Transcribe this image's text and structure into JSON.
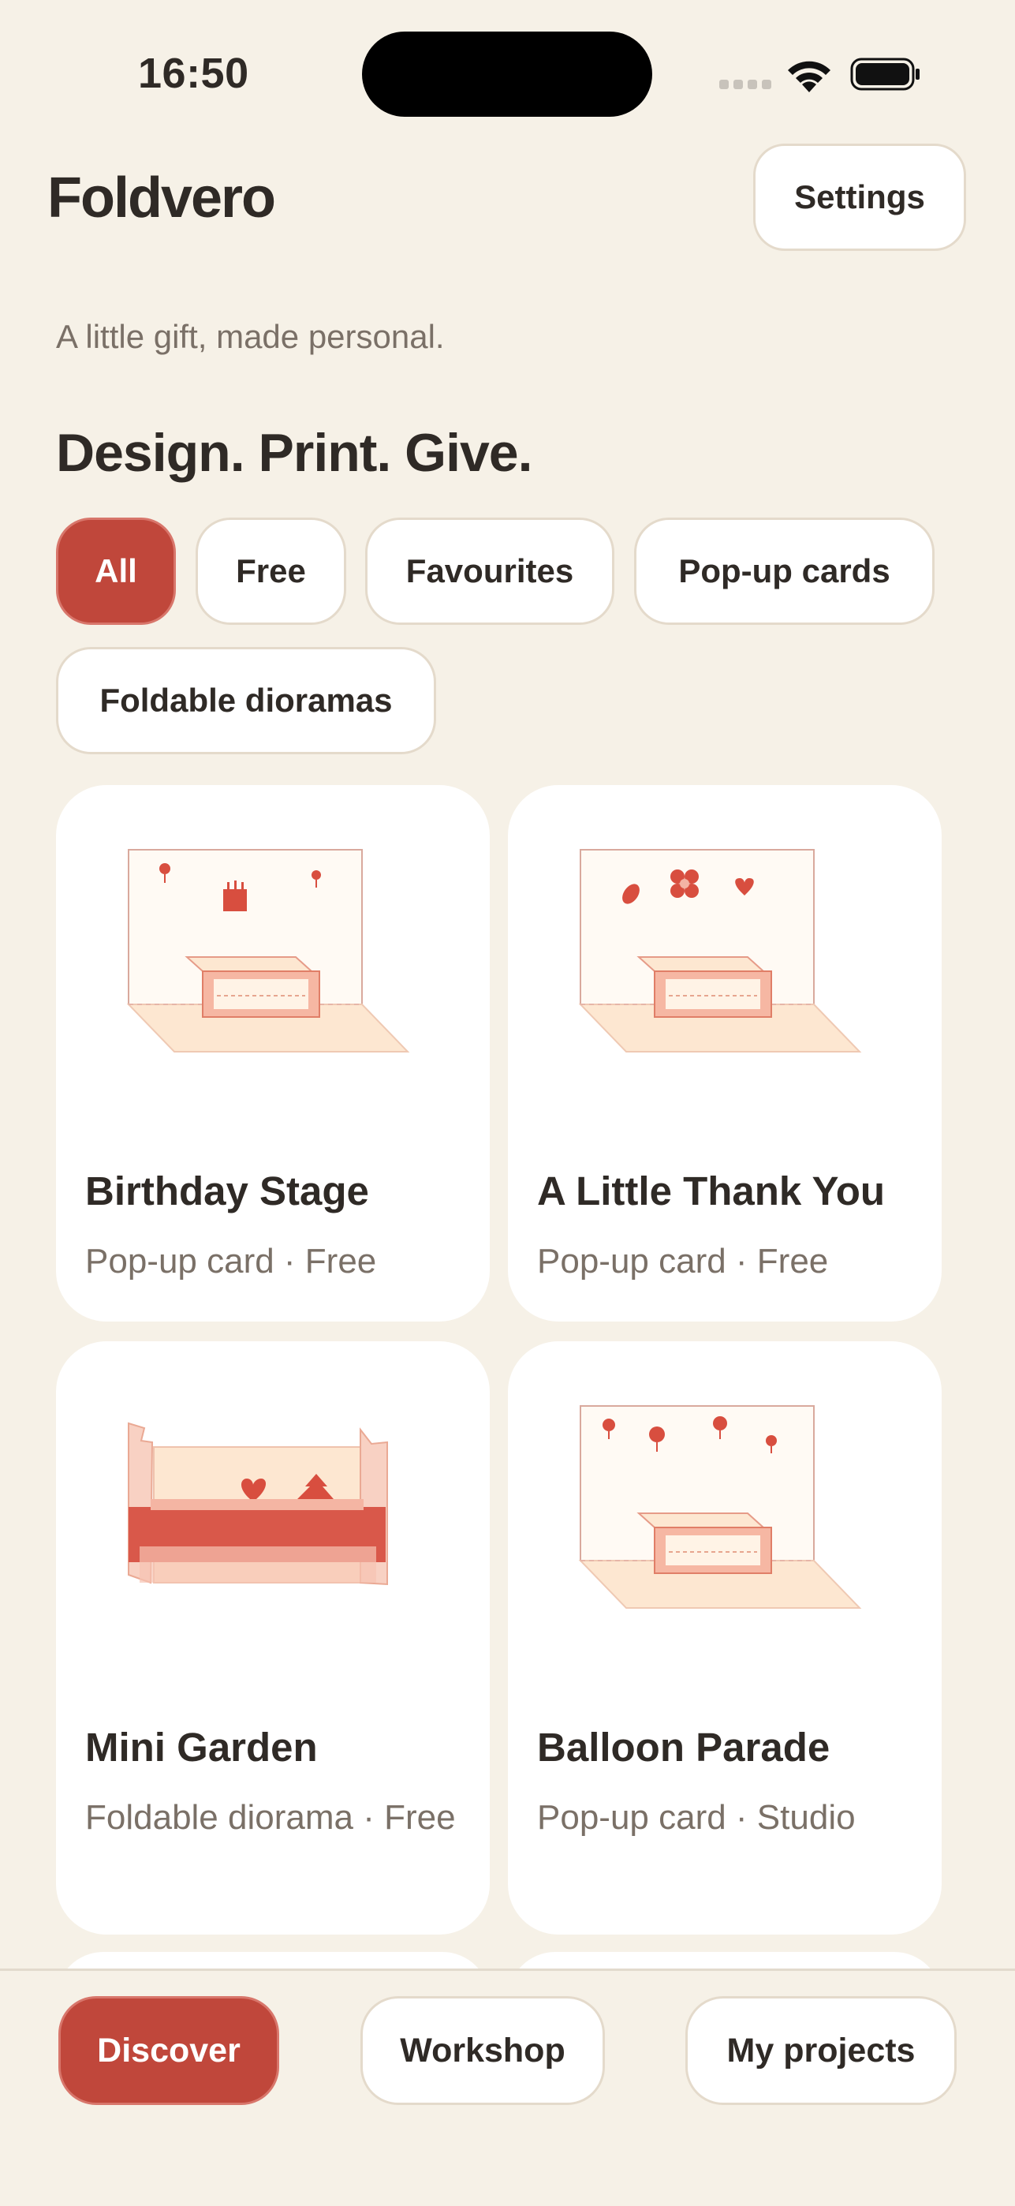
{
  "status_bar": {
    "time": "16:50"
  },
  "header": {
    "title": "Foldvero",
    "settings_label": "Settings",
    "tagline": "A little gift, made personal.",
    "headline": "Design. Print. Give."
  },
  "filters": [
    "All",
    "Free",
    "Favourites",
    "Pop-up cards",
    "Foldable dioramas"
  ],
  "active_filter": "All",
  "cards": [
    {
      "title": "Birthday Stage",
      "subtitle": "Pop-up card · Free",
      "icon": "birthday-popup-illustration"
    },
    {
      "title": "A Little Thank You",
      "subtitle": "Pop-up card · Free",
      "icon": "thank-you-popup-illustration"
    },
    {
      "title": "Mini Garden",
      "subtitle": "Foldable diorama · Free",
      "icon": "garden-diorama-illustration"
    },
    {
      "title": "Balloon Parade",
      "subtitle": "Pop-up card · Studio",
      "icon": "balloon-popup-illustration"
    }
  ],
  "nav": {
    "discover": "Discover",
    "workshop": "Workshop",
    "my_projects": "My projects"
  },
  "colors": {
    "accent": "#c0473b",
    "background": "#f6f1e7",
    "card": "#ffffff",
    "muted_text": "#7a7067"
  }
}
